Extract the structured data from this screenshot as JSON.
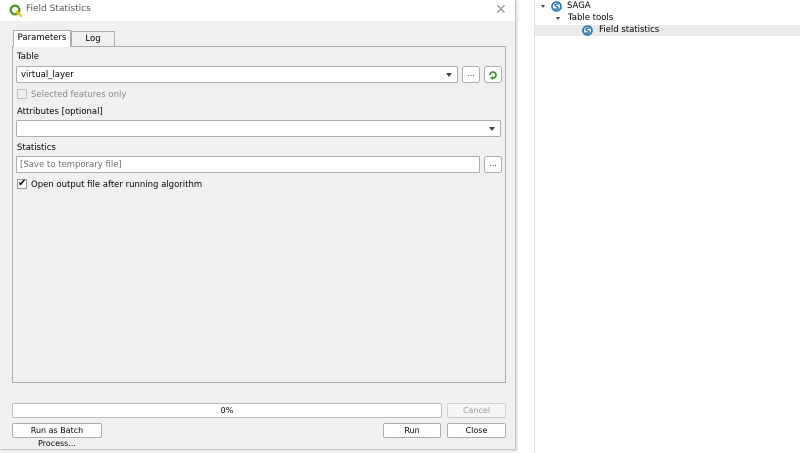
{
  "dialog": {
    "title": "Field Statistics",
    "tabs": [
      {
        "label": "Parameters",
        "active": true
      },
      {
        "label": "Log",
        "active": false
      }
    ],
    "table": {
      "label": "Table",
      "value": "virtual_layer",
      "browse_label": "...",
      "selected_only_label": "Selected features only",
      "selected_only_checked": false
    },
    "attributes": {
      "label": "Attributes [optional]",
      "value": ""
    },
    "statistics": {
      "label": "Statistics",
      "placeholder": "[Save to temporary file]",
      "browse_label": "..."
    },
    "open_output": {
      "label": "Open output file after running algorithm",
      "checked": true
    },
    "progress": {
      "value": 0,
      "text": "0%"
    },
    "buttons": {
      "cancel": "Cancel",
      "batch": "Run as Batch Process...",
      "run": "Run",
      "close": "Close"
    }
  },
  "toolbox": {
    "provider": "SAGA",
    "group": "Table tools",
    "algorithm": "Field statistics"
  },
  "colors": {
    "dialog_bg": "#f0f0f0",
    "qgis_green": "#589632",
    "saga_blue": "#1f6fb5",
    "selection": "#eaeaea"
  }
}
